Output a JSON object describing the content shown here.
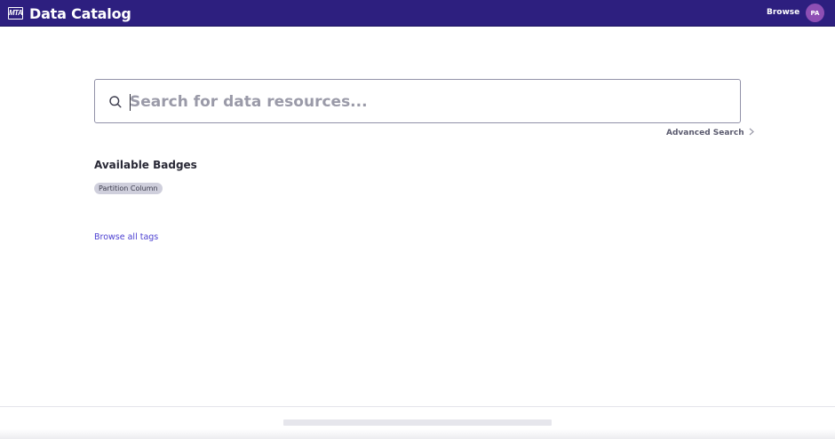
{
  "header": {
    "logo_text": "MTA",
    "app_title": "Data Catalog",
    "nav_browse": "Browse",
    "avatar_initials": "PA",
    "bar_color": "#2d1f7f",
    "avatar_color": "#8e4fb4"
  },
  "search": {
    "placeholder": "Search for data resources...",
    "icon": "search-icon",
    "advanced_label": "Advanced Search",
    "advanced_icon": "chevron-right-icon"
  },
  "badges": {
    "title": "Available Badges",
    "items": [
      {
        "label": "Partition Column"
      }
    ]
  },
  "tags": {
    "browse_all_label": "Browse all tags",
    "link_color": "#4b3fd1"
  }
}
